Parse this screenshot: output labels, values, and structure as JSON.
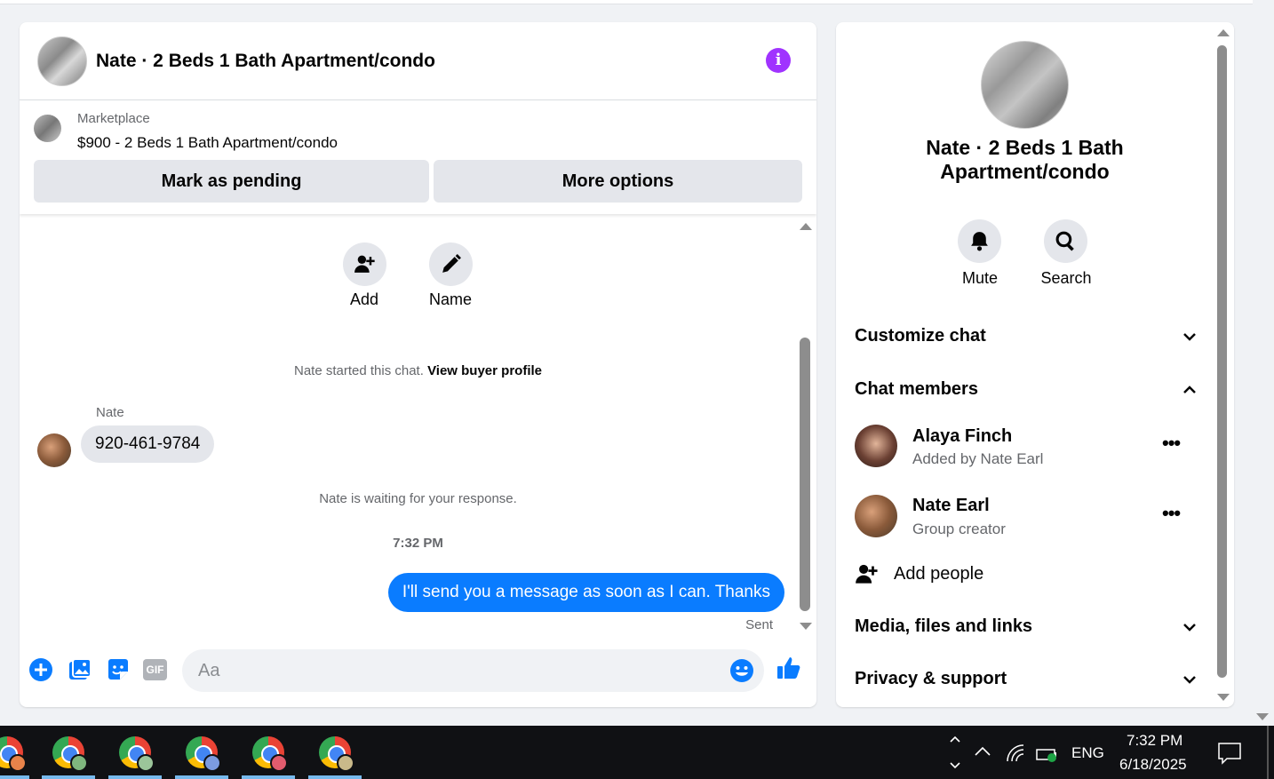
{
  "chat_header": {
    "title": "Nate · 2 Beds 1 Bath Apartment/condo"
  },
  "marketplace": {
    "label": "Marketplace",
    "listing": "$900 - 2 Beds 1 Bath Apartment/condo",
    "mark_pending_label": "Mark as pending",
    "more_options_label": "More options"
  },
  "actions": {
    "add_label": "Add",
    "name_label": "Name"
  },
  "messages": {
    "started_text": "Nate started this chat.",
    "view_profile_link": "View buyer profile",
    "sender_name": "Nate",
    "incoming_text": "920-461-9784",
    "waiting_text": "Nate is waiting for your response.",
    "timestamp": "7:32 PM",
    "outgoing_text": "I'll send you a message as soon as I can. Thanks",
    "status": "Sent"
  },
  "composer": {
    "placeholder": "Aa",
    "gif_label": "GIF"
  },
  "details": {
    "title": "Nate · 2 Beds 1 Bath Apartment/condo",
    "mute_label": "Mute",
    "search_label": "Search",
    "customize_chat": "Customize chat",
    "chat_members": "Chat members",
    "members": [
      {
        "name": "Alaya Finch",
        "subtitle": "Added by Nate Earl"
      },
      {
        "name": "Nate Earl",
        "subtitle": "Group creator"
      }
    ],
    "add_people": "Add people",
    "media_files": "Media, files and links",
    "privacy_support": "Privacy & support"
  },
  "taskbar": {
    "language": "ENG",
    "time": "7:32 PM",
    "date": "6/18/2025"
  },
  "colors": {
    "accent_blue": "#0a7cff",
    "info_purple": "#a033ff",
    "gray_button": "#e4e6eb"
  }
}
